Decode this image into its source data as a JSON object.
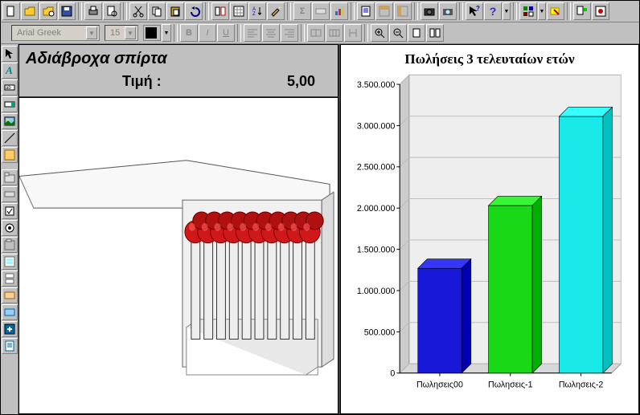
{
  "toolbar1": {
    "icons": [
      "new-file",
      "open-file",
      "open-db",
      "save",
      "print",
      "print-preview",
      "cut",
      "copy",
      "paste",
      "undo",
      "field-list",
      "grid",
      "sort",
      "autoformat",
      "sum",
      "control",
      "chart",
      "report",
      "ruler-h",
      "ruler-v",
      "camera",
      "snapshot",
      "cursor-help",
      "help",
      "align",
      "layers",
      "group",
      "wizard"
    ]
  },
  "toolbar2": {
    "font": "Arial Greek",
    "font_size": "15",
    "bold": "B",
    "italic": "I",
    "underline": "U",
    "align_left": "L",
    "align_center": "C",
    "align_right": "R",
    "zoom_in": "+",
    "zoom_out": "-"
  },
  "sidebox": {
    "tools": [
      "select",
      "label",
      "text",
      "combo",
      "picture",
      "line",
      "rect",
      "tab",
      "button",
      "checkbox",
      "option",
      "frame",
      "subform",
      "page-break",
      "unbound",
      "bound",
      "more",
      "report"
    ]
  },
  "product": {
    "title": "Αδιάβροχα σπίρτα",
    "price_label": "Τιμή :",
    "price_value": "5,00"
  },
  "chart_data": {
    "type": "bar",
    "title": "Πωλήσεις 3 τελευταίων ετών",
    "categories": [
      "Πωλησεις00",
      "Πωλησεις-1",
      "Πωλησεις-2"
    ],
    "values": [
      1270000,
      2030000,
      3110000
    ],
    "ylabel": "",
    "ylim": [
      0,
      3500000
    ],
    "yticks": [
      0,
      500000,
      1000000,
      1500000,
      2000000,
      2500000,
      3000000,
      3500000
    ],
    "ytick_labels": [
      "0",
      "500.000",
      "1.000.000",
      "1.500.000",
      "2.000.000",
      "2.500.000",
      "3.000.000",
      "3.500.000"
    ],
    "colors": [
      "#1818d8",
      "#18d818",
      "#18e8e8"
    ]
  }
}
